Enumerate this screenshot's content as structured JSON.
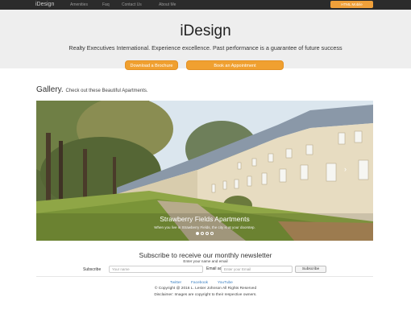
{
  "navbar": {
    "brand": "iDesign",
    "links": [
      "Amenities",
      "Faq",
      "Contact Us",
      "About Me"
    ],
    "button_label": "HTML Mobile"
  },
  "hero": {
    "title": "iDesign",
    "subtitle": "Realty Executives International. Experience excellence. Past performance is a guarantee of future success",
    "buttons": [
      "Download a Brochure",
      "Book an Appointment"
    ]
  },
  "gallery": {
    "heading": "Gallery.",
    "subheading": "Check out these Beautiful Apartments.",
    "slide": {
      "title": "Strawberry Fields Apartments",
      "caption": "When you live in Strawberry Fields, the city is at your doorstep."
    },
    "next_arrow": "›",
    "indicator_count": 4,
    "active_indicator": 1
  },
  "newsletter": {
    "title": "Subscribe to receive our monthly newsletter",
    "subtitle": "Enter your name and email",
    "subscribe_label": "Subscribe",
    "name_placeholder": "Your name",
    "email_label": "Email address",
    "email_placeholder": "Enter your Email",
    "button_label": "Subscribe"
  },
  "footer": {
    "social": [
      "Twitter",
      "Facebook",
      "YouTube"
    ],
    "copyright": "© Copyright @ 2016 L. Lester Johnson All Rights Reserved",
    "disclaimer": "Disclaimer: Images are copyright to their respective owners."
  },
  "colors": {
    "navbar_bg": "#2b2b2b",
    "accent_orange": "#f0a030",
    "hero_bg": "#eeeeee",
    "link_blue": "#3a7fc1"
  }
}
